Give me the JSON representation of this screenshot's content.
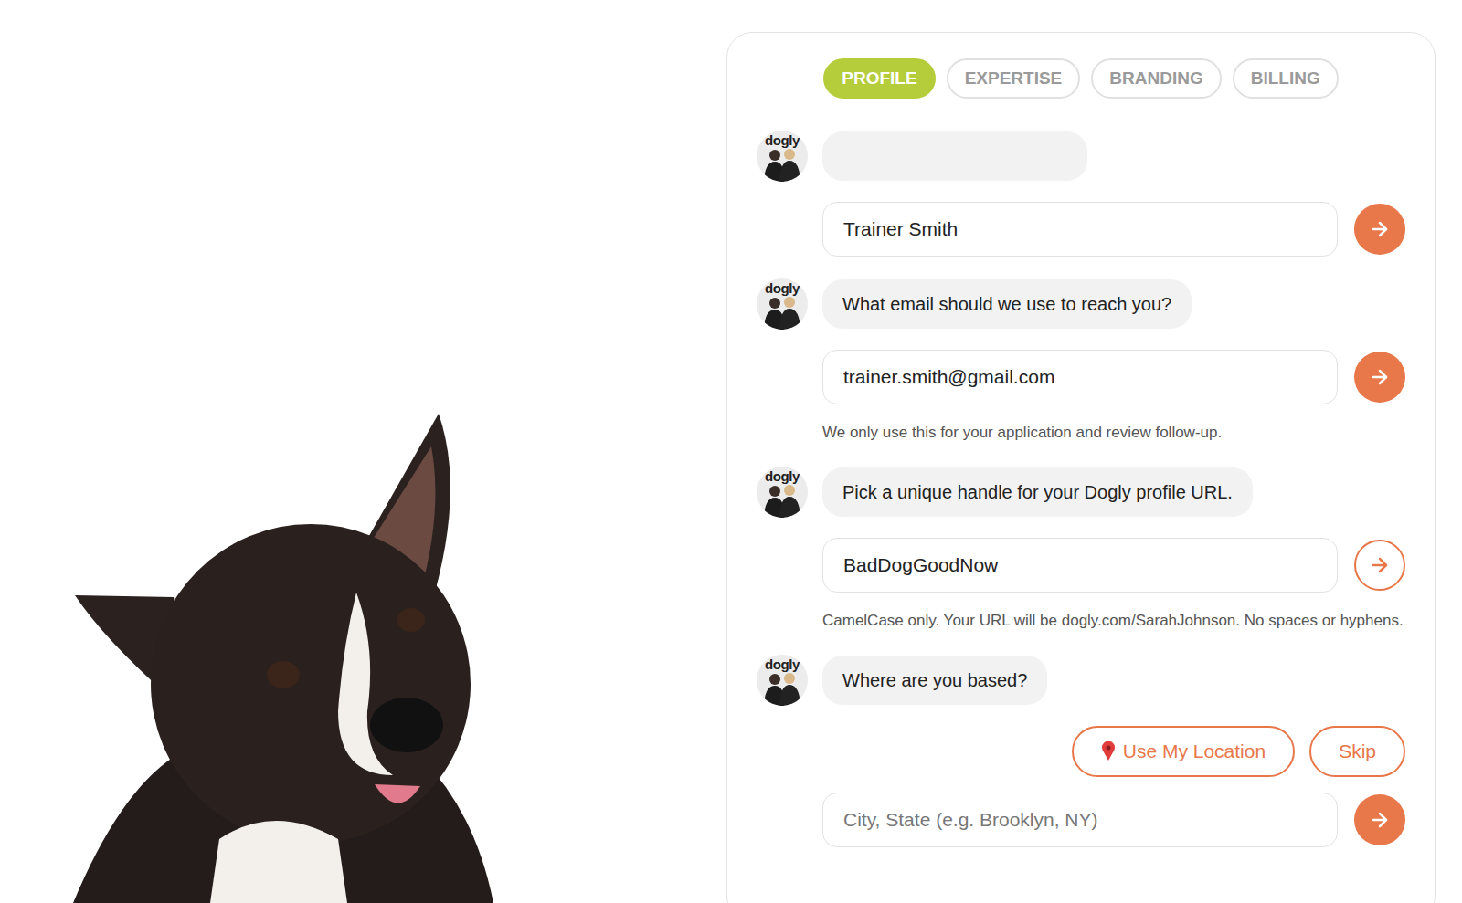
{
  "tabs": [
    {
      "label": "PROFILE",
      "selected": true
    },
    {
      "label": "EXPERTISE",
      "selected": false
    },
    {
      "label": "BRANDING",
      "selected": false
    },
    {
      "label": "BILLING",
      "selected": false
    }
  ],
  "avatar_logo": "dogly",
  "steps": [
    {
      "question": "",
      "actions": [],
      "input": {
        "value": "Trainer Smith",
        "placeholder": ""
      },
      "submit_active": true,
      "hint": ""
    },
    {
      "question": "What email should we use to reach you?",
      "actions": [],
      "input": {
        "value": "trainer.smith@gmail.com",
        "placeholder": ""
      },
      "submit_active": true,
      "hint": "We only use this for your application and review follow-up."
    },
    {
      "question": "Pick a unique handle for your Dogly profile URL.",
      "actions": [],
      "input": {
        "value": "BadDogGoodNow",
        "placeholder": ""
      },
      "submit_active": false,
      "hint": "CamelCase only. Your URL will be dogly.com/SarahJohnson. No spaces or hyphens."
    },
    {
      "question": "Where are you based?",
      "actions": [
        {
          "label": "Use My Location",
          "kind": "location"
        },
        {
          "label": "Skip",
          "kind": "plain"
        }
      ],
      "input": {
        "value": "",
        "placeholder": "City, State (e.g. Brooklyn, NY)"
      },
      "submit_active": true,
      "hint": ""
    }
  ]
}
